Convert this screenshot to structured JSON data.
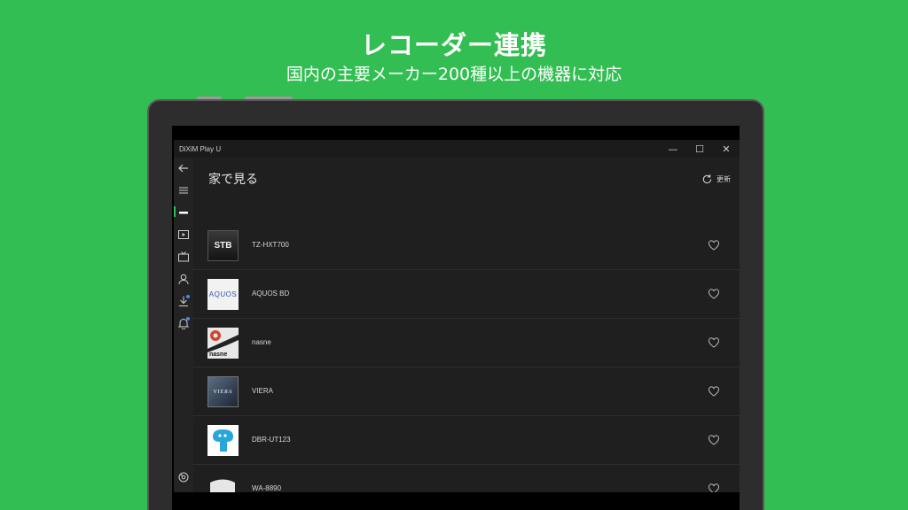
{
  "promo": {
    "title": "レコーダー連携",
    "subtitle": "国内の主要メーカー200種以上の機器に対応"
  },
  "window": {
    "title": "DiXiM Play U",
    "controls": [
      "—",
      "☐",
      "✕"
    ]
  },
  "sidebar": {
    "items": [
      {
        "name": "back",
        "icon": "arrow-left-icon"
      },
      {
        "name": "menu",
        "icon": "hamburger-icon"
      },
      {
        "name": "home-devices",
        "icon": "recorder-icon",
        "active": true
      },
      {
        "name": "video",
        "icon": "play-icon"
      },
      {
        "name": "tv",
        "icon": "tv-icon"
      },
      {
        "name": "account",
        "icon": "person-icon"
      },
      {
        "name": "download",
        "icon": "download-icon",
        "badge": true
      },
      {
        "name": "notifications",
        "icon": "bell-icon",
        "badge": true
      },
      {
        "name": "settings",
        "icon": "gear-icon"
      }
    ]
  },
  "main": {
    "heading": "家で見る",
    "refresh_label": "更新",
    "devices": [
      {
        "name": "TZ-HXT700",
        "thumb": "STB",
        "thumb_style": "stb"
      },
      {
        "name": "AQUOS BD",
        "thumb": "AQUOS",
        "thumb_style": "aquos"
      },
      {
        "name": "nasne",
        "thumb": "nasne",
        "thumb_style": "nasne"
      },
      {
        "name": "VIERA",
        "thumb": "VIERA",
        "thumb_style": "viera"
      },
      {
        "name": "DBR-UT123",
        "thumb": "",
        "thumb_style": "dbr"
      },
      {
        "name": "WA-8890",
        "thumb": "",
        "thumb_style": "wa"
      }
    ]
  },
  "colors": {
    "background": "#32be52",
    "accent": "#32be52",
    "badge": "#3a8ff0"
  }
}
